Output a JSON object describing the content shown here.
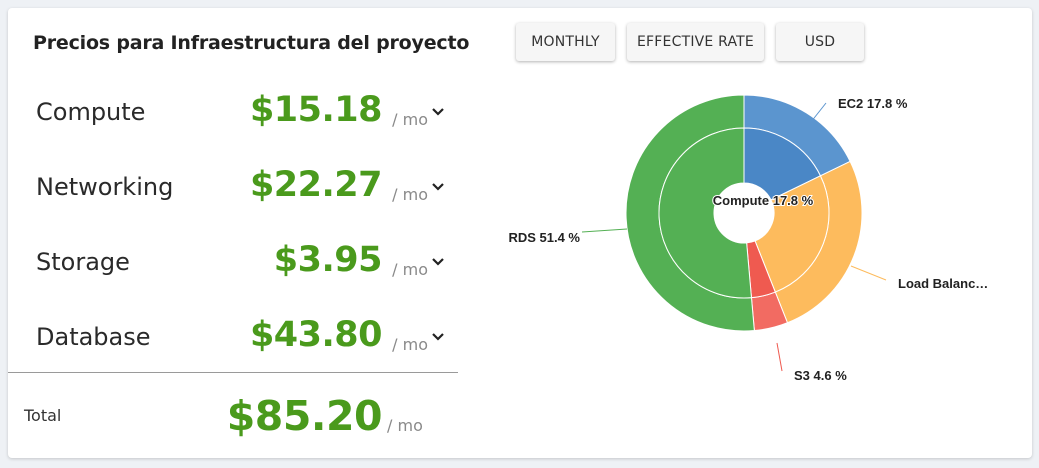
{
  "header": {
    "title": "Precios para Infraestructura del proyecto"
  },
  "toolbar": {
    "monthly_label": "MONTHLY",
    "rate_label": "EFFECTIVE RATE",
    "currency_label": "USD"
  },
  "costs": [
    {
      "label": "Compute",
      "price": "$15.18",
      "unit": "/ mo"
    },
    {
      "label": "Networking",
      "price": "$22.27",
      "unit": "/ mo"
    },
    {
      "label": "Storage",
      "price": "$3.95",
      "unit": "/ mo"
    },
    {
      "label": "Database",
      "price": "$43.80",
      "unit": "/ mo"
    }
  ],
  "total": {
    "label": "Total",
    "price": "$85.20",
    "unit": "/ mo"
  },
  "colors": {
    "price": "#4a9a1c",
    "compute": "#5592cc",
    "networking": "#fdbb5d",
    "storage": "#ef5a50",
    "database": "#54b054"
  },
  "chart_data": {
    "type": "pie",
    "inner_ring": [
      {
        "name": "Compute",
        "value": 17.8,
        "color": "#4a87c6"
      },
      {
        "name": "Networking",
        "value": 26.2,
        "color": "#fdbb5d"
      },
      {
        "name": "Storage",
        "value": 4.6,
        "color": "#ef5a50"
      },
      {
        "name": "Database",
        "value": 51.4,
        "color": "#54b054"
      }
    ],
    "outer_ring": [
      {
        "name": "EC2",
        "value": 17.8,
        "color": "#5b95cf"
      },
      {
        "name": "Load Balancer",
        "value": 26.2,
        "color": "#fdbb5d"
      },
      {
        "name": "S3",
        "value": 4.6,
        "color": "#f26b62"
      },
      {
        "name": "RDS",
        "value": 51.4,
        "color": "#54b054"
      }
    ],
    "labels": {
      "ec2": "EC2 17.8 %",
      "lb": "Load Balanc…",
      "s3": "S3 4.6 %",
      "rds": "RDS 51.4 %",
      "compute": "Compute 17.8 %"
    }
  }
}
